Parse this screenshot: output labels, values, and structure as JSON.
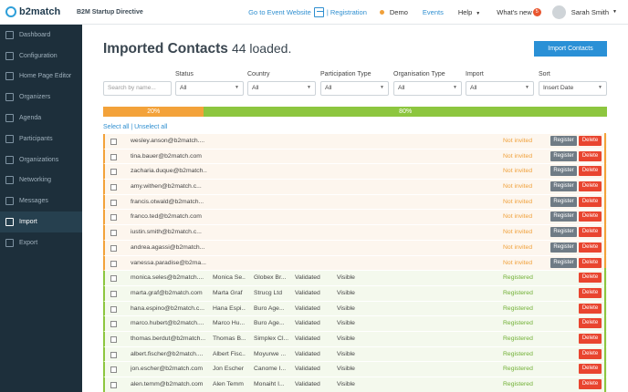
{
  "topbar": {
    "logo_text": "b2match",
    "event_name": "B2M Startup Directive",
    "goto_event": "Go to Event Website",
    "registration": "Registration",
    "demo": "Demo",
    "events": "Events",
    "help": "Help",
    "whats_new": "What's new",
    "whats_new_count": "5",
    "user_name": "Sarah Smith"
  },
  "sidebar": {
    "items": [
      {
        "label": "Dashboard"
      },
      {
        "label": "Configuration"
      },
      {
        "label": "Home Page Editor"
      },
      {
        "label": "Organizers"
      },
      {
        "label": "Agenda"
      },
      {
        "label": "Participants"
      },
      {
        "label": "Organizations"
      },
      {
        "label": "Networking"
      },
      {
        "label": "Messages"
      },
      {
        "label": "Import"
      },
      {
        "label": "Export"
      }
    ]
  },
  "main": {
    "title": "Imported Contacts",
    "loaded": "44 loaded.",
    "import_button": "Import Contacts",
    "search_placeholder": "Search by name...",
    "filters": [
      {
        "label": "Status",
        "value": "All"
      },
      {
        "label": "Country",
        "value": "All"
      },
      {
        "label": "Participation Type",
        "value": "All"
      },
      {
        "label": "Organisation Type",
        "value": "All"
      },
      {
        "label": "Import",
        "value": "All"
      },
      {
        "label": "Sort",
        "value": "Insert Date"
      }
    ],
    "progress": {
      "pending_label": "20%",
      "registered_label": "80%",
      "pending_fraction": 0.2,
      "registered_fraction": 0.8
    },
    "select_all": "Select all",
    "unselect_all": "Unselect all",
    "register_label": "Register",
    "delete_label": "Delete",
    "rows": [
      {
        "email": "wesley.anson@b2match....",
        "name": "",
        "org": "",
        "validated": "",
        "visible": "",
        "status": "Not invited",
        "kind": "pend"
      },
      {
        "email": "tina.bauer@b2match.com",
        "name": "",
        "org": "",
        "validated": "",
        "visible": "",
        "status": "Not invited",
        "kind": "pend"
      },
      {
        "email": "zacharia.duque@b2match...",
        "name": "",
        "org": "",
        "validated": "",
        "visible": "",
        "status": "Not invited",
        "kind": "pend"
      },
      {
        "email": "amy.withen@b2match.c...",
        "name": "",
        "org": "",
        "validated": "",
        "visible": "",
        "status": "Not invited",
        "kind": "pend"
      },
      {
        "email": "francis.otwald@b2match...",
        "name": "",
        "org": "",
        "validated": "",
        "visible": "",
        "status": "Not invited",
        "kind": "pend"
      },
      {
        "email": "franco.ted@b2match.com",
        "name": "",
        "org": "",
        "validated": "",
        "visible": "",
        "status": "Not invited",
        "kind": "pend"
      },
      {
        "email": "iustin.smith@b2match.c...",
        "name": "",
        "org": "",
        "validated": "",
        "visible": "",
        "status": "Not invited",
        "kind": "pend"
      },
      {
        "email": "andrea.agassi@b2match...",
        "name": "",
        "org": "",
        "validated": "",
        "visible": "",
        "status": "Not invited",
        "kind": "pend"
      },
      {
        "email": "vanessa.paradise@b2ma...",
        "name": "",
        "org": "",
        "validated": "",
        "visible": "",
        "status": "Not invited",
        "kind": "pend"
      },
      {
        "email": "monica.seles@b2match....",
        "name": "Monica Se...",
        "org": "Globex Br...",
        "validated": "Validated",
        "visible": "Visible",
        "status": "Registered",
        "kind": "reg"
      },
      {
        "email": "marta.graf@b2match.com",
        "name": "Marta Graf",
        "org": "Strucg Ltd",
        "validated": "Validated",
        "visible": "Visible",
        "status": "Registered",
        "kind": "reg"
      },
      {
        "email": "hana.espino@b2match.c...",
        "name": "Hana Espi...",
        "org": "Buro Age...",
        "validated": "Validated",
        "visible": "Visible",
        "status": "Registered",
        "kind": "reg"
      },
      {
        "email": "marco.hubert@b2match....",
        "name": "Marco Hu...",
        "org": "Buro Age...",
        "validated": "Validated",
        "visible": "Visible",
        "status": "Registered",
        "kind": "reg"
      },
      {
        "email": "thomas.berdut@b2match...",
        "name": "Thomas B...",
        "org": "Simplex Cl...",
        "validated": "Validated",
        "visible": "Visible",
        "status": "Registered",
        "kind": "reg"
      },
      {
        "email": "albert.fischer@b2match....",
        "name": "Albert Fisc...",
        "org": "Moyurwe ...",
        "validated": "Validated",
        "visible": "Visible",
        "status": "Registered",
        "kind": "reg"
      },
      {
        "email": "jon.escher@b2match.com",
        "name": "Jon Escher",
        "org": "Canome I...",
        "validated": "Validated",
        "visible": "Visible",
        "status": "Registered",
        "kind": "reg"
      },
      {
        "email": "alen.temm@b2match.com",
        "name": "Alen Temm",
        "org": "Monaiht I...",
        "validated": "Validated",
        "visible": "Visible",
        "status": "Registered",
        "kind": "reg"
      }
    ]
  },
  "colors": {
    "accent": "#2a90d6",
    "pending": "#f3a23a",
    "registered": "#8dc63f",
    "delete": "#e9452f",
    "sidebar": "#1d2f3b"
  }
}
